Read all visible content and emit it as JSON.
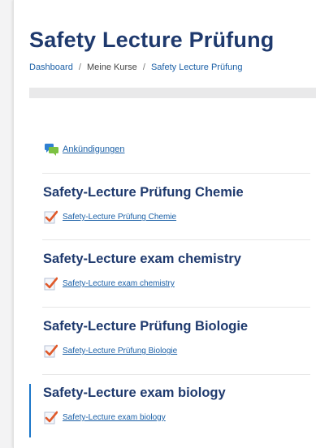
{
  "header": {
    "title": "Safety Lecture Prüfung"
  },
  "breadcrumb": {
    "items": [
      {
        "label": "Dashboard",
        "link": true
      },
      {
        "label": "Meine Kurse",
        "link": false
      },
      {
        "label": "Safety Lecture Prüfung",
        "link": true
      }
    ],
    "separator": "/"
  },
  "announcements": {
    "label": "Ankündigungen",
    "icon": "forum-icon"
  },
  "sections": [
    {
      "title": "Safety-Lecture Prüfung Chemie",
      "activity": "Safety-Lecture Prüfung Chemie",
      "icon": "quiz-icon"
    },
    {
      "title": "Safety-Lecture exam chemistry",
      "activity": "Safety-Lecture exam chemistry",
      "icon": "quiz-icon"
    },
    {
      "title": "Safety-Lecture Prüfung Biologie",
      "activity": "Safety-Lecture Prüfung Biologie",
      "icon": "quiz-icon"
    },
    {
      "title": "Safety-Lecture exam biology",
      "activity": "Safety-Lecture exam biology",
      "icon": "quiz-icon"
    }
  ],
  "colors": {
    "title": "#1f3a6e",
    "link": "#1a5fa6",
    "accent": "#1a76c9",
    "check": "#e05a2b"
  }
}
